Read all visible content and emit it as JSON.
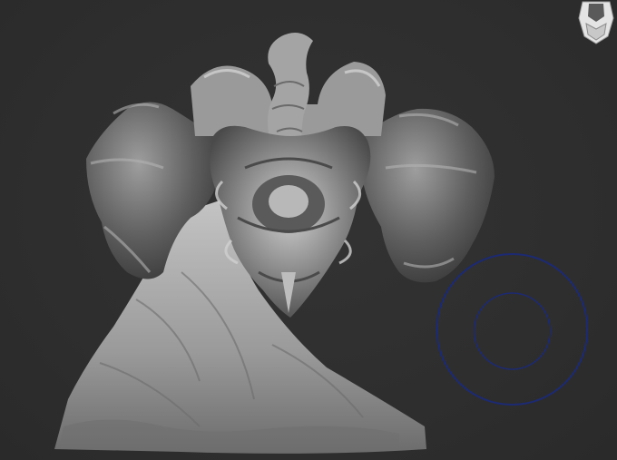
{
  "viewport": {
    "background_color": "#303030",
    "model_color": "#8a8a8a",
    "brush_color": "#1c2a72",
    "icons": {
      "navigation_gizmo": "orientation-head-icon",
      "brush_cursor": "brush-circle-icon"
    }
  }
}
